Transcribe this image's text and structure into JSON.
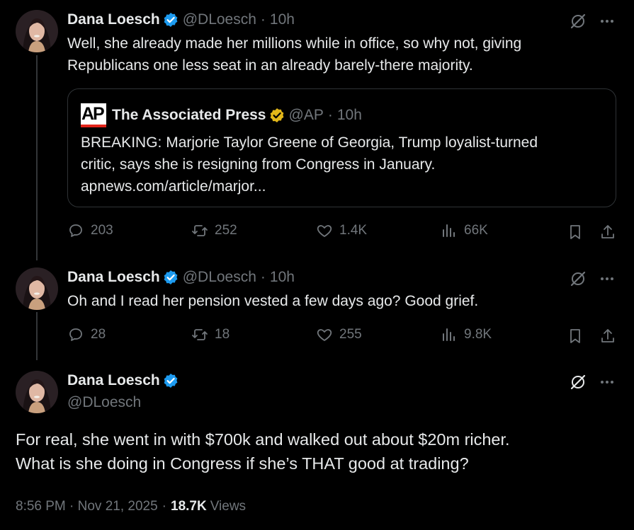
{
  "tweets": [
    {
      "author_name": "Dana Loesch",
      "handle": "@DLoesch",
      "time": "10h",
      "text_lines": [
        "Well, she already made her millions while in office, so why not, giving",
        "Republicans one less seat in an already barely-there majority."
      ],
      "quote": {
        "badge": "AP",
        "author_name": "The Associated Press",
        "handle": "@AP",
        "time": "10h",
        "text_lines": [
          "BREAKING: Marjorie Taylor Greene of Georgia, Trump loyalist-turned",
          "critic, says she is resigning from Congress in January.",
          "apnews.com/article/marjor..."
        ]
      },
      "replies": "203",
      "reposts": "252",
      "likes": "1.4K",
      "views": "66K"
    },
    {
      "author_name": "Dana Loesch",
      "handle": "@DLoesch",
      "time": "10h",
      "text_lines": [
        "Oh and I read her pension vested a few days ago? Good grief."
      ],
      "replies": "28",
      "reposts": "18",
      "likes": "255",
      "views": "9.8K"
    }
  ],
  "main_tweet": {
    "author_name": "Dana Loesch",
    "handle": "@DLoesch",
    "text_lines": [
      "For real, she went in with $700k and walked out about $20m richer.",
      "What is she doing in Congress if she’s THAT good at trading?"
    ],
    "timestamp": "8:56 PM · Nov 21, 2025",
    "views_count": "18.7K",
    "views_label": "Views"
  },
  "separator": "·",
  "colors": {
    "background": "#000000",
    "text": "#e7e9ea",
    "muted": "#71767b",
    "verified_blue": "#1d9bf0",
    "verified_gold": "#e2b719",
    "border": "#2f3336"
  },
  "icons": [
    "verified-badge-icon",
    "grok-icon",
    "more-icon",
    "reply-icon",
    "repost-icon",
    "like-icon",
    "views-icon",
    "bookmark-icon",
    "share-icon"
  ]
}
